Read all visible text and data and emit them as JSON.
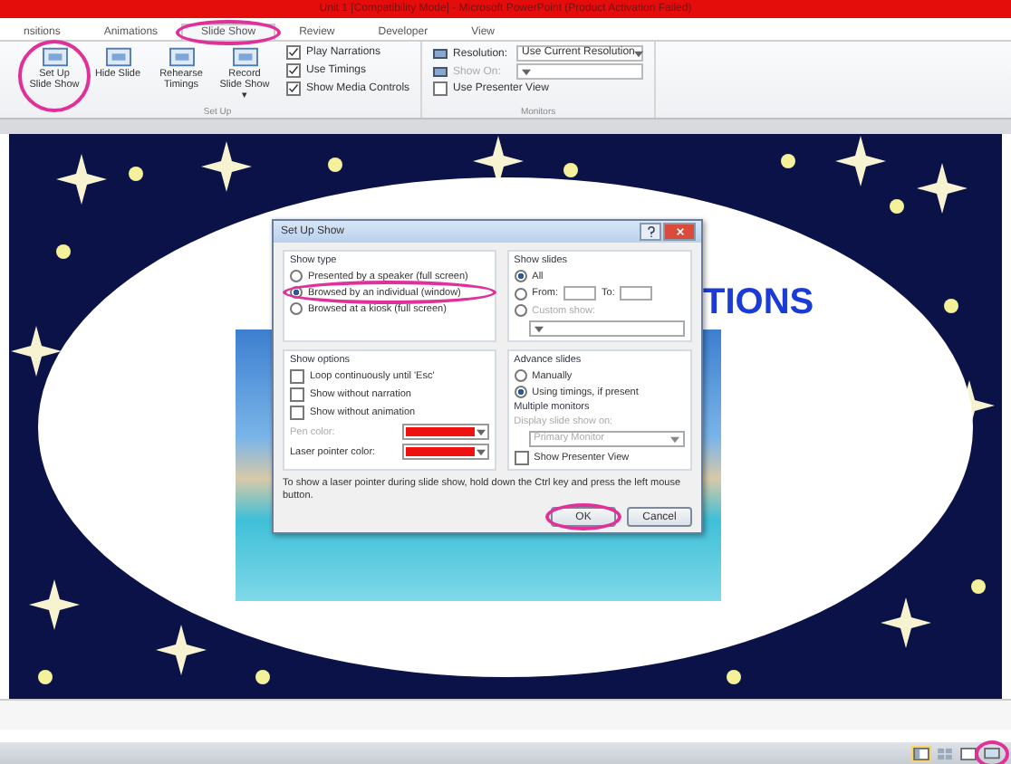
{
  "window": {
    "title": "Unit 1 [Compatibility Mode] - Microsoft PowerPoint (Product Activation Failed)"
  },
  "tabs": [
    {
      "label": "nsitions",
      "selected": false,
      "circled": false
    },
    {
      "label": "Animations",
      "selected": false,
      "circled": false
    },
    {
      "label": "Slide Show",
      "selected": true,
      "circled": true
    },
    {
      "label": "Review",
      "selected": false,
      "circled": false
    },
    {
      "label": "Developer",
      "selected": false,
      "circled": false
    },
    {
      "label": "View",
      "selected": false,
      "circled": false
    }
  ],
  "ribbon": {
    "setup_group": {
      "label": "Set Up",
      "buttons": [
        {
          "label": "Set Up Slide Show",
          "circled": true
        },
        {
          "label": "Hide Slide",
          "circled": false
        },
        {
          "label": "Rehearse Timings",
          "circled": false
        },
        {
          "label": "Record Slide Show ▾",
          "circled": false
        }
      ],
      "options": [
        {
          "label": "Play Narrations",
          "checked": true
        },
        {
          "label": "Use Timings",
          "checked": true
        },
        {
          "label": "Show Media Controls",
          "checked": true
        }
      ]
    },
    "monitors_group": {
      "label": "Monitors",
      "rows": [
        {
          "kind": "dropdown",
          "label": "Resolution:",
          "value": "Use Current Resolution",
          "disabled": false
        },
        {
          "kind": "dropdown",
          "label": "Show On:",
          "value": "",
          "disabled": true
        },
        {
          "kind": "checkbox",
          "label": "Use Presenter View",
          "checked": false,
          "disabled": false
        }
      ]
    }
  },
  "slide": {
    "title": "TIONS"
  },
  "dialog": {
    "title": "Set Up Show",
    "show_type": {
      "label": "Show type",
      "options": [
        {
          "label": "Presented by a speaker (full screen)",
          "selected": false,
          "circled": false
        },
        {
          "label": "Browsed by an individual (window)",
          "selected": true,
          "circled": true
        },
        {
          "label": "Browsed at a kiosk (full screen)",
          "selected": false,
          "circled": false
        }
      ]
    },
    "show_slides": {
      "label": "Show slides",
      "all": {
        "label": "All",
        "selected": true
      },
      "from": {
        "label": "From:",
        "selected": false
      },
      "to_label": "To:",
      "custom": {
        "label": "Custom show:",
        "selected": false,
        "disabled": true
      }
    },
    "show_options": {
      "label": "Show options",
      "checks": [
        {
          "label": "Loop continuously until 'Esc'",
          "checked": false
        },
        {
          "label": "Show without narration",
          "checked": false
        },
        {
          "label": "Show without animation",
          "checked": false
        }
      ],
      "colors": [
        {
          "label": "Pen color:",
          "color": "#ee1111",
          "disabled": true
        },
        {
          "label": "Laser pointer color:",
          "color": "#ee1111",
          "disabled": false
        }
      ]
    },
    "advance": {
      "label": "Advance slides",
      "options": [
        {
          "label": "Manually",
          "selected": false
        },
        {
          "label": "Using timings, if present",
          "selected": true
        }
      ]
    },
    "monitors": {
      "label": "Multiple monitors",
      "display_label": "Display slide show on:",
      "display_value": "Primary Monitor",
      "presenter": {
        "label": "Show Presenter View",
        "checked": false
      }
    },
    "note": "To show a laser pointer during slide show, hold down the Ctrl key and press the left mouse button.",
    "buttons": [
      {
        "label": "OK",
        "circled": true
      },
      {
        "label": "Cancel",
        "circled": false
      }
    ]
  },
  "status_bar": {
    "views": [
      {
        "kind": "normal",
        "selected": true,
        "circled": false
      },
      {
        "kind": "sorter",
        "selected": false,
        "circled": false
      },
      {
        "kind": "reading",
        "selected": false,
        "circled": false
      },
      {
        "kind": "slideshow",
        "selected": false,
        "circled": true
      }
    ]
  }
}
